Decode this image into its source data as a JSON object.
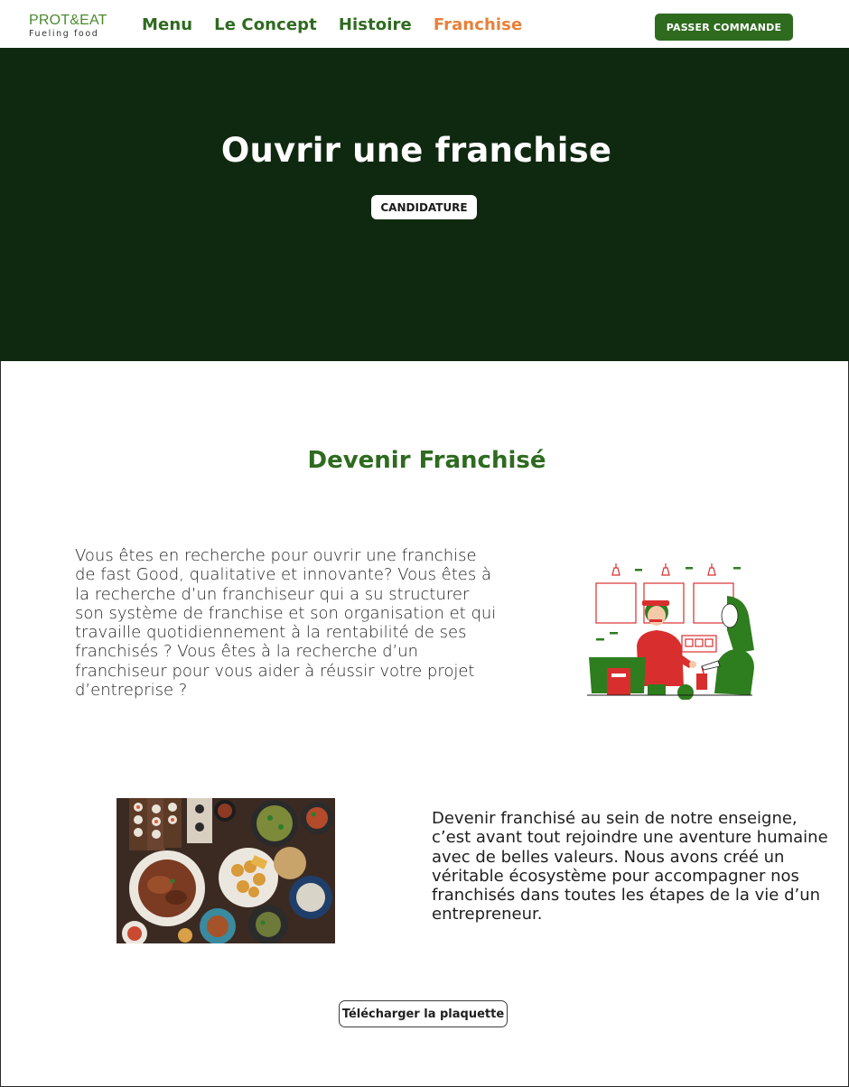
{
  "header": {
    "logo_main": "PROT&EAT",
    "logo_sub": "Fueling food",
    "nav": [
      {
        "label": "Menu"
      },
      {
        "label": "Le Concept"
      },
      {
        "label": "Histoire"
      },
      {
        "label": "Franchise"
      }
    ],
    "active_nav": "Franchise",
    "order_button": "PASSER COMMANDE"
  },
  "hero": {
    "title": "Ouvrir une franchise",
    "button": "CANDIDATURE"
  },
  "section": {
    "title": "Devenir Franchisé",
    "paragraph1": "Vous êtes en recherche pour ouvrir une franchise de fast Good, qualitative et innovante? Vous êtes à la recherche d’un franchiseur qui a su structurer son système de franchise et son organisation et qui travaille quotidiennement à la rentabilité de ses franchisés ? Vous êtes à la recherche d’un franchiseur pour vous aider à réussir votre projet d’entreprise ?",
    "paragraph2": "Devenir franchisé au sein de notre enseigne, c’est avant tout rejoindre une aventure humaine avec de belles valeurs. Nous avons créé un véritable écosystème pour accompagner nos franchisés dans toutes les étapes de la vie d’un entrepreneur.",
    "download_button": "Télécharger la plaquette"
  },
  "colors": {
    "brand_green": "#2e6b1f",
    "hero_bg": "#0f2910",
    "accent_orange": "#e8803a",
    "illustration_red": "#d92e2e"
  }
}
